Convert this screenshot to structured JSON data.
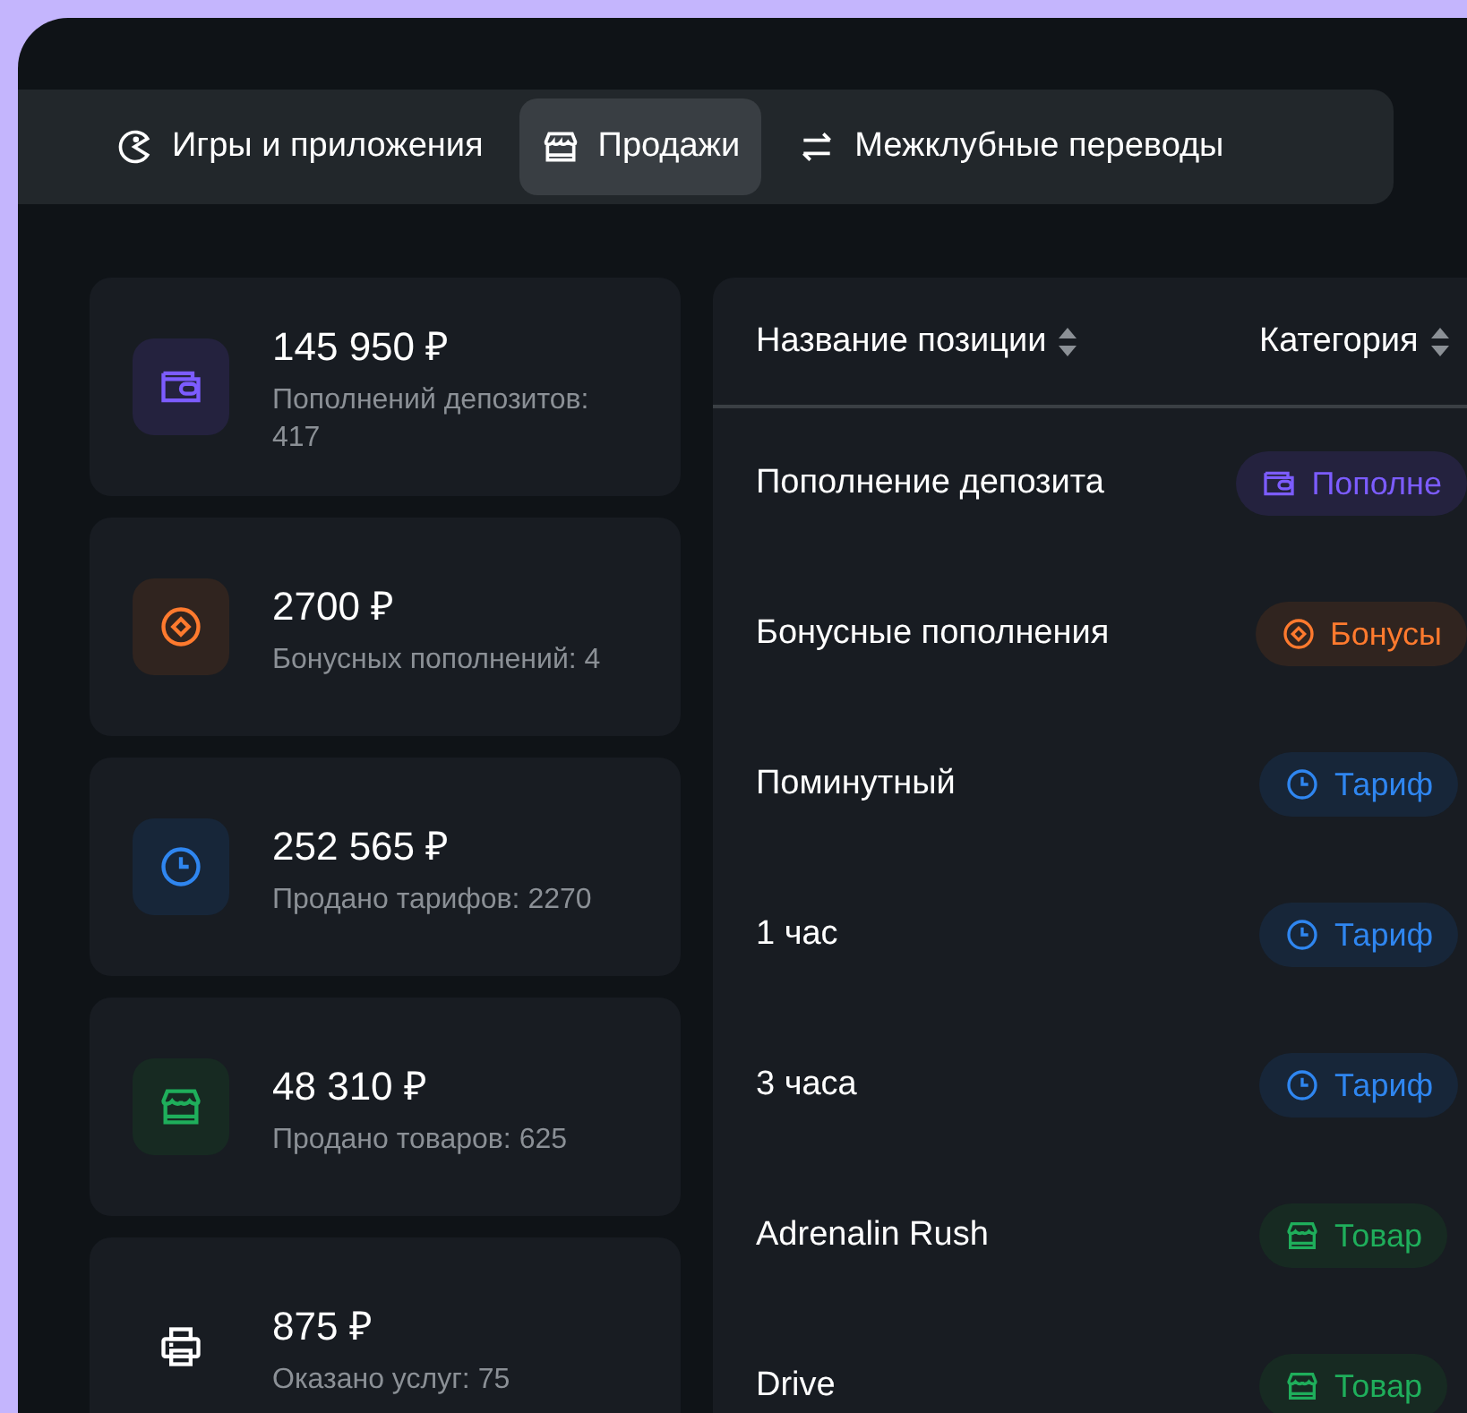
{
  "tabs": [
    {
      "label": "Игры и приложения",
      "kind": "game",
      "selected": false
    },
    {
      "label": "Продажи",
      "kind": "store",
      "selected": true
    },
    {
      "label": "Межклубные переводы",
      "kind": "transfer",
      "selected": false
    }
  ],
  "cards": [
    {
      "kind": "deposit",
      "amount": "145 950 ₽",
      "caption": "Пополнений депозитов: 417"
    },
    {
      "kind": "bonus",
      "amount": "2700 ₽",
      "caption": "Бонусных пополнений: 4"
    },
    {
      "kind": "tariff",
      "amount": "252 565 ₽",
      "caption": "Продано тарифов: 2270"
    },
    {
      "kind": "goods",
      "amount": "48 310 ₽",
      "caption": "Продано товаров: 625"
    },
    {
      "kind": "service",
      "amount": "875 ₽",
      "caption": "Оказано услуг: 75"
    }
  ],
  "table": {
    "columns": [
      "Название позиции",
      "Категория"
    ],
    "rows": [
      {
        "name": "Пополнение депозита",
        "category": "Пополне",
        "kind": "deposit"
      },
      {
        "name": "Бонусные пополнения",
        "category": "Бонусы",
        "kind": "bonus"
      },
      {
        "name": "Поминутный",
        "category": "Тариф",
        "kind": "tariff"
      },
      {
        "name": "1 час",
        "category": "Тариф",
        "kind": "tariff"
      },
      {
        "name": "3 часа",
        "category": "Тариф",
        "kind": "tariff"
      },
      {
        "name": "Adrenalin Rush",
        "category": "Товар",
        "kind": "goods"
      },
      {
        "name": "Drive",
        "category": "Товар",
        "kind": "goods"
      }
    ]
  }
}
